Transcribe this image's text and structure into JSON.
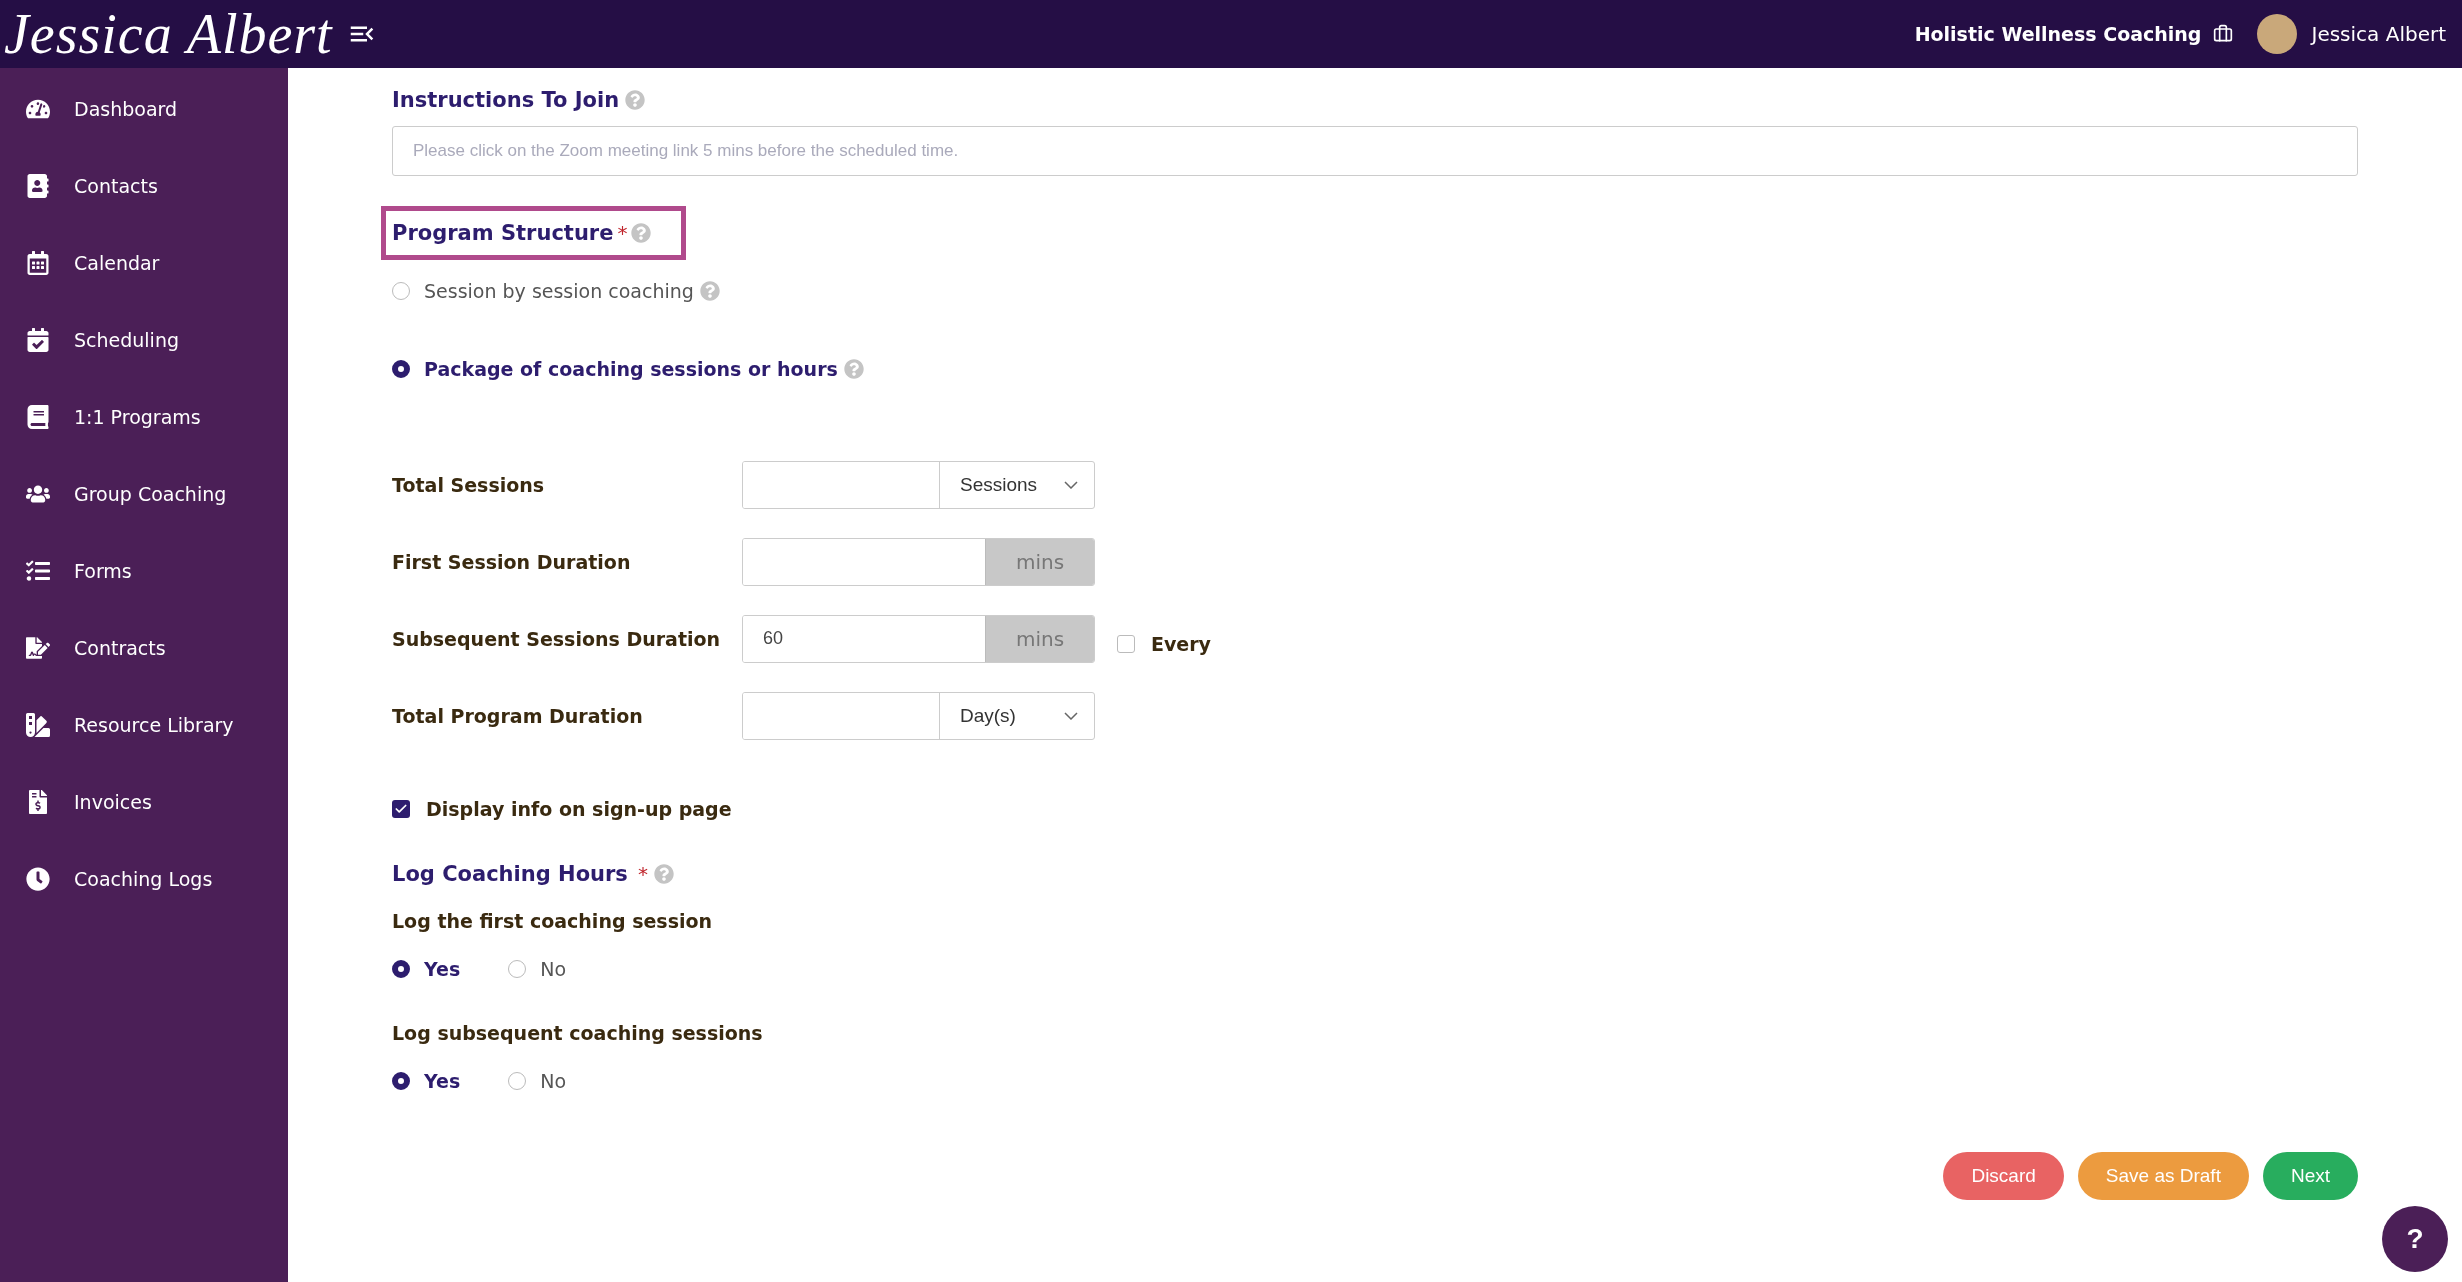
{
  "header": {
    "logo": "Jessica Albert",
    "business": "Holistic Wellness Coaching",
    "user_name": "Jessica Albert"
  },
  "sidebar": {
    "items": [
      {
        "label": "Dashboard"
      },
      {
        "label": "Contacts"
      },
      {
        "label": "Calendar"
      },
      {
        "label": "Scheduling"
      },
      {
        "label": "1:1 Programs"
      },
      {
        "label": "Group Coaching"
      },
      {
        "label": "Forms"
      },
      {
        "label": "Contracts"
      },
      {
        "label": "Resource Library"
      },
      {
        "label": "Invoices"
      },
      {
        "label": "Coaching Logs"
      }
    ]
  },
  "instructions": {
    "label": "Instructions To Join",
    "placeholder": "Please click on the Zoom meeting link 5 mins before the scheduled time."
  },
  "program_structure": {
    "label": "Program Structure",
    "required": "*",
    "options": [
      {
        "label": "Session by session coaching",
        "selected": false
      },
      {
        "label": "Package of coaching sessions or hours",
        "selected": true
      }
    ]
  },
  "fields": [
    {
      "label": "Total Sessions",
      "kind": "select",
      "addon": "Sessions"
    },
    {
      "label": "First Session Duration",
      "kind": "unit",
      "addon": "mins"
    },
    {
      "label": "Subsequent Sessions Duration",
      "kind": "unit",
      "value": "60",
      "addon": "mins",
      "extra": {
        "label": "Every",
        "checked": false
      }
    },
    {
      "label": "Total Program Duration",
      "kind": "select",
      "addon": "Day(s)"
    }
  ],
  "display_info": {
    "label": "Display info on sign-up page",
    "checked": true
  },
  "log_hours": {
    "title": "Log Coaching Hours",
    "required": "*",
    "questions": [
      {
        "label": "Log the first coaching session",
        "options": [
          {
            "label": "Yes",
            "selected": true
          },
          {
            "label": "No",
            "selected": false
          }
        ]
      },
      {
        "label": "Log subsequent coaching sessions",
        "options": [
          {
            "label": "Yes",
            "selected": true
          },
          {
            "label": "No",
            "selected": false
          }
        ]
      }
    ]
  },
  "buttons": [
    {
      "label": "Discard",
      "kind": "discard"
    },
    {
      "label": "Save as Draft",
      "kind": "draft"
    },
    {
      "label": "Next",
      "kind": "next"
    }
  ],
  "help_button": "?"
}
